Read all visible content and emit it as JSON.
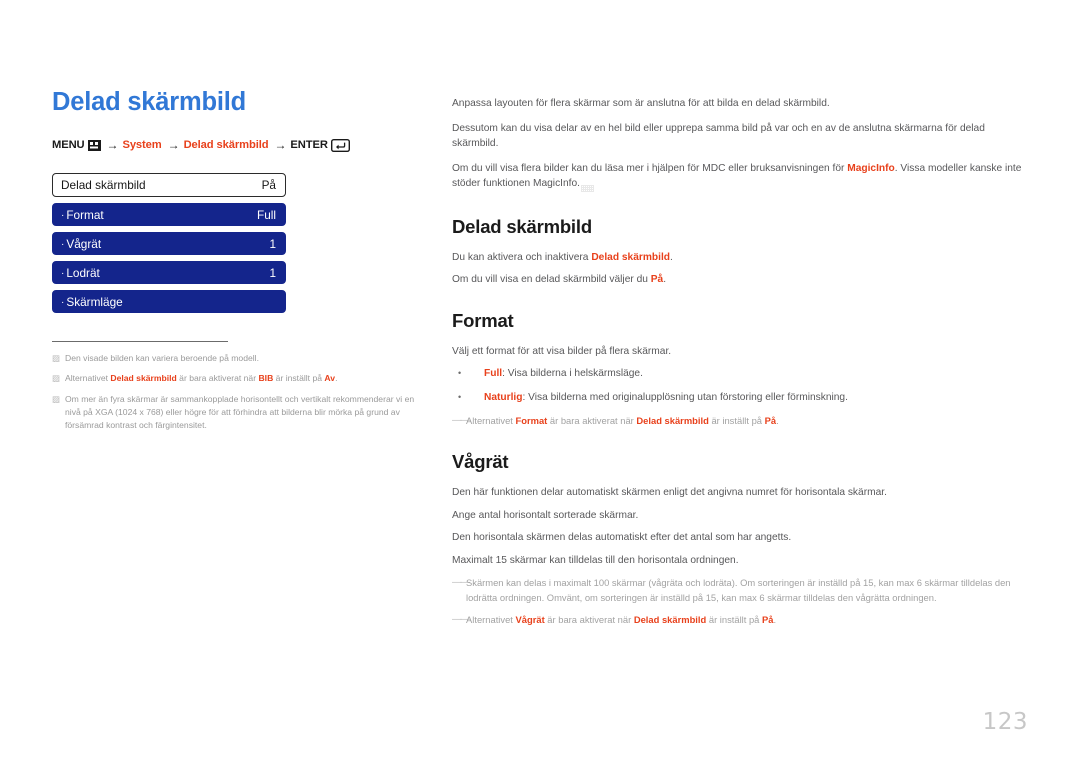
{
  "colors": {
    "title_blue": "#3178d6",
    "osd_blue": "#14258c",
    "accent_red": "#e8411c",
    "body_gray": "#58585a",
    "note_gray": "#a2a2a2",
    "page_number_gray": "#c7c7c7"
  },
  "left": {
    "page_title": "Delad skärmbild",
    "breadcrumb": {
      "menu_label": "MENU",
      "menu_icon": "remote-menu-button-icon",
      "arrow": "→",
      "step1": "System",
      "step2": "Delad skärmbild",
      "enter_label": "ENTER",
      "enter_icon": "enter-return-key-icon"
    },
    "osd": {
      "header": {
        "label": "Delad skärmbild",
        "value": "På"
      },
      "items": [
        {
          "bullet": "·",
          "label": "Format",
          "value": "Full"
        },
        {
          "bullet": "·",
          "label": "Vågrät",
          "value": "1"
        },
        {
          "bullet": "·",
          "label": "Lodrät",
          "value": "1"
        },
        {
          "bullet": "·",
          "label": "Skärmläge",
          "value": ""
        }
      ]
    },
    "notes": [
      {
        "marker": "▨",
        "parts": [
          {
            "t": "Den visade bilden kan variera beroende på modell.",
            "style": "plain"
          }
        ]
      },
      {
        "marker": "▨",
        "parts": [
          {
            "t": "Alternativet ",
            "style": "plain"
          },
          {
            "t": "Delad skärmbild",
            "style": "red"
          },
          {
            "t": " är bara aktiverat när ",
            "style": "plain"
          },
          {
            "t": "BIB",
            "style": "red"
          },
          {
            "t": " är inställt på ",
            "style": "plain"
          },
          {
            "t": "Av",
            "style": "red"
          },
          {
            "t": ".",
            "style": "plain"
          }
        ]
      },
      {
        "marker": "▨",
        "parts": [
          {
            "t": "Om mer än fyra skärmar är sammankopplade horisontellt och vertikalt rekommenderar vi en nivå på XGA (1024 x 768) eller högre för att förhindra att bilderna blir mörka på grund av försämrad kontrast och färgintensitet.",
            "style": "plain"
          }
        ]
      }
    ]
  },
  "right": {
    "intro": [
      [
        {
          "t": "Anpassa layouten för flera skärmar som är anslutna för att bilda en delad skärmbild.",
          "style": "plain"
        }
      ],
      [
        {
          "t": "Dessutom kan du visa delar av en hel bild eller upprepa samma bild på var och en av de anslutna skärmarna för delad skärmbild.",
          "style": "plain"
        }
      ],
      [
        {
          "t": "Om du vill visa flera bilder kan du läsa mer i hjälpen för MDC eller bruksanvisningen för ",
          "style": "plain"
        },
        {
          "t": "MagicInfo",
          "style": "red"
        },
        {
          "t": ". Vissa modeller kanske inte stöder funktionen MagicInfo.",
          "style": "plain"
        }
      ]
    ],
    "sections": [
      {
        "heading": "Delad skärmbild",
        "paragraphs": [
          [
            {
              "t": "Du kan aktivera och inaktivera ",
              "style": "plain"
            },
            {
              "t": "Delad skärmbild",
              "style": "red"
            },
            {
              "t": ".",
              "style": "plain"
            }
          ],
          [
            {
              "t": "Om du vill visa en delad skärmbild väljer du ",
              "style": "plain"
            },
            {
              "t": "På",
              "style": "red"
            },
            {
              "t": ".",
              "style": "plain"
            }
          ]
        ],
        "bullets": [],
        "dash_notes": []
      },
      {
        "heading": "Format",
        "paragraphs": [
          [
            {
              "t": "Välj ett format för att visa bilder på flera skärmar.",
              "style": "plain"
            }
          ]
        ],
        "bullets": [
          [
            {
              "t": "Full",
              "style": "red"
            },
            {
              "t": ": Visa bilderna i helskärmsläge.",
              "style": "plain"
            }
          ],
          [
            {
              "t": "Naturlig",
              "style": "red"
            },
            {
              "t": ": Visa bilderna med originalupplösning utan förstoring eller förminskning.",
              "style": "plain"
            }
          ]
        ],
        "dash_notes": [
          [
            {
              "t": "Alternativet ",
              "style": "plain"
            },
            {
              "t": "Format",
              "style": "red"
            },
            {
              "t": " är bara aktiverat när ",
              "style": "plain"
            },
            {
              "t": "Delad skärmbild",
              "style": "red"
            },
            {
              "t": " är inställt på ",
              "style": "plain"
            },
            {
              "t": "På",
              "style": "red"
            },
            {
              "t": ".",
              "style": "plain"
            }
          ]
        ]
      },
      {
        "heading": "Vågrät",
        "paragraphs": [
          [
            {
              "t": "Den här funktionen delar automatiskt skärmen enligt det angivna numret för horisontala skärmar.",
              "style": "plain"
            }
          ],
          [
            {
              "t": "Ange antal horisontalt sorterade skärmar.",
              "style": "plain"
            }
          ],
          [
            {
              "t": "Den horisontala skärmen delas automatiskt efter det antal som har angetts.",
              "style": "plain"
            }
          ],
          [
            {
              "t": "Maximalt 15 skärmar kan tilldelas till den horisontala ordningen.",
              "style": "plain"
            }
          ]
        ],
        "bullets": [],
        "dash_notes": [
          [
            {
              "t": "Skärmen kan delas i maximalt 100 skärmar (vågräta och lodräta). Om sorteringen är inställd på 15, kan max 6 skärmar tilldelas den lodrätta ordningen. Omvänt, om sorteringen är inställd på 15, kan max 6 skärmar tilldelas den vågrätta ordningen.",
              "style": "plain"
            }
          ],
          [
            {
              "t": "Alternativet ",
              "style": "plain"
            },
            {
              "t": "Vågrät",
              "style": "red"
            },
            {
              "t": " är bara aktiverat när ",
              "style": "plain"
            },
            {
              "t": "Delad skärmbild",
              "style": "red"
            },
            {
              "t": " är inställt på ",
              "style": "plain"
            },
            {
              "t": "På",
              "style": "red"
            },
            {
              "t": ".",
              "style": "plain"
            }
          ]
        ]
      }
    ]
  },
  "footer": {
    "page_number": "123"
  }
}
